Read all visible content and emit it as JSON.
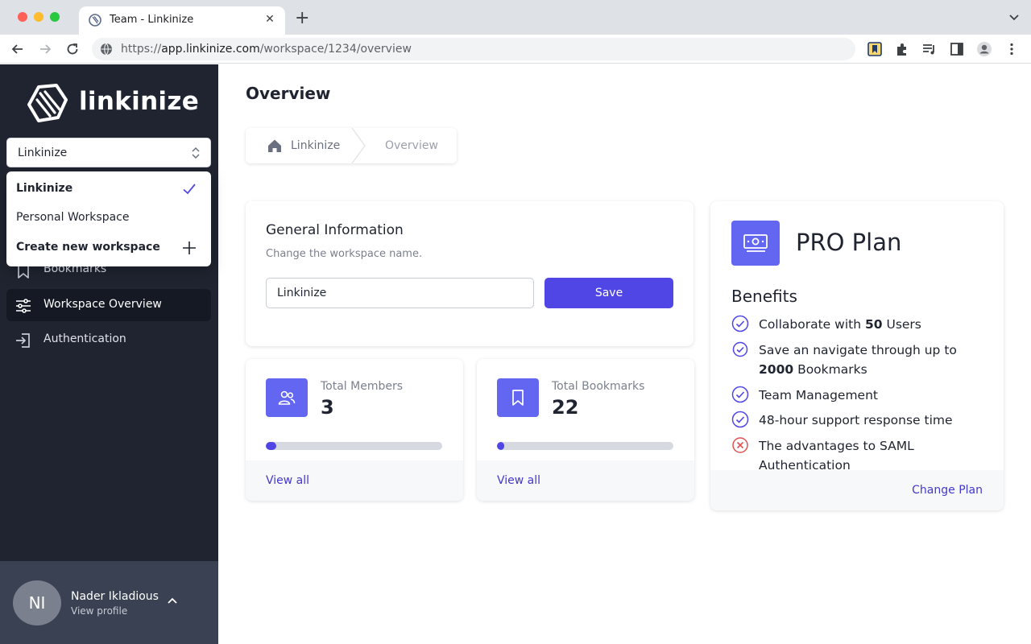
{
  "browser": {
    "tab_title": "Team - Linkinize",
    "new_tab_symbol": "+",
    "close_symbol": "✕",
    "url_scheme": "https://",
    "url_host": "app.linkinize.com",
    "url_path": "/workspace/1234/overview"
  },
  "sidebar": {
    "logo_text": "linkinize",
    "workspace_select": {
      "value": "Linkinize"
    },
    "workspace_dropdown": {
      "items": [
        {
          "label": "Linkinize",
          "selected": true,
          "icon": "check-icon"
        },
        {
          "label": "Personal Workspace",
          "selected": false
        },
        {
          "label": "Create new workspace",
          "icon": "plus-icon"
        }
      ]
    },
    "nav": [
      {
        "label": "Bookmarks",
        "icon": "bookmark-icon",
        "active": false
      },
      {
        "label": "Workspace Overview",
        "icon": "sliders-icon",
        "active": true
      },
      {
        "label": "Authentication",
        "icon": "sign-in-icon",
        "active": false
      }
    ],
    "profile": {
      "initials": "NI",
      "name": "Nader Ikladious",
      "link": "View profile"
    }
  },
  "main": {
    "title": "Overview",
    "breadcrumb": {
      "root": "Linkinize",
      "current": "Overview"
    },
    "general_info": {
      "title": "General Information",
      "subtitle": "Change the workspace name.",
      "name_value": "Linkinize",
      "save_label": "Save"
    },
    "stats": [
      {
        "label": "Total Members",
        "value": "3",
        "icon": "users-icon",
        "progress": 0.06,
        "link": "View all"
      },
      {
        "label": "Total Bookmarks",
        "value": "22",
        "icon": "bookmark-icon",
        "progress": 0.011,
        "link": "View all"
      }
    ],
    "plan": {
      "title": "PRO Plan",
      "icon": "cash-icon",
      "benefits_title": "Benefits",
      "benefits": [
        {
          "pre": "Collaborate with ",
          "bold": "50",
          "post": " Users",
          "included": true
        },
        {
          "pre": "Save an navigate through up to ",
          "bold": "2000",
          "post": " Bookmarks",
          "included": true
        },
        {
          "pre": "Team Management",
          "bold": "",
          "post": "",
          "included": true
        },
        {
          "pre": "48-hour support response time",
          "bold": "",
          "post": "",
          "included": true
        },
        {
          "pre": "The advantages to SAML Authentication",
          "bold": "",
          "post": "",
          "included": false
        }
      ],
      "change_label": "Change Plan"
    }
  },
  "colors": {
    "sidebar_bg": "#1f2430",
    "accent": "#4f46e5",
    "icon_tile": "#6366f1",
    "link": "#4338ca",
    "error": "#e05252"
  }
}
